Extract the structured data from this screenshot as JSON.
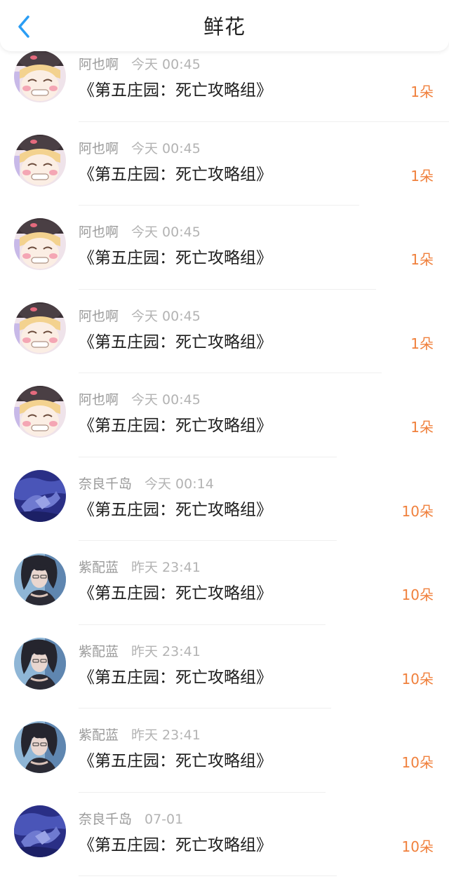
{
  "header": {
    "title": "鲜花",
    "back_icon": "chevron-left-icon",
    "accent_color": "#2a9df4"
  },
  "colors": {
    "count": "#f0803c",
    "name": "#9a9a9a",
    "title_text": "#1e1e1e"
  },
  "items": [
    {
      "name": "阿也啊",
      "time": "今天 00:45",
      "book": "《第五庄园：死亡攻略组》",
      "count": "1朵",
      "avatar": "anime-girl-avatar"
    },
    {
      "name": "阿也啊",
      "time": "今天 00:45",
      "book": "《第五庄园：死亡攻略组》",
      "count": "1朵",
      "avatar": "anime-girl-avatar"
    },
    {
      "name": "阿也啊",
      "time": "今天 00:45",
      "book": "《第五庄园：死亡攻略组》",
      "count": "1朵",
      "avatar": "anime-girl-avatar"
    },
    {
      "name": "阿也啊",
      "time": "今天 00:45",
      "book": "《第五庄园：死亡攻略组》",
      "count": "1朵",
      "avatar": "anime-girl-avatar"
    },
    {
      "name": "阿也啊",
      "time": "今天 00:45",
      "book": "《第五庄园：死亡攻略组》",
      "count": "1朵",
      "avatar": "anime-girl-avatar"
    },
    {
      "name": "奈良千岛",
      "time": "今天 00:14",
      "book": "《第五庄园：死亡攻略组》",
      "count": "10朵",
      "avatar": "blue-night-avatar"
    },
    {
      "name": "紫配蓝",
      "time": "昨天 23:41",
      "book": "《第五庄园：死亡攻略组》",
      "count": "10朵",
      "avatar": "dark-hair-avatar"
    },
    {
      "name": "紫配蓝",
      "time": "昨天 23:41",
      "book": "《第五庄园：死亡攻略组》",
      "count": "10朵",
      "avatar": "dark-hair-avatar"
    },
    {
      "name": "紫配蓝",
      "time": "昨天 23:41",
      "book": "《第五庄园：死亡攻略组》",
      "count": "10朵",
      "avatar": "dark-hair-avatar"
    },
    {
      "name": "奈良千岛",
      "time": "07-01",
      "book": "《第五庄园：死亡攻略组》",
      "count": "10朵",
      "avatar": "blue-night-avatar"
    }
  ]
}
